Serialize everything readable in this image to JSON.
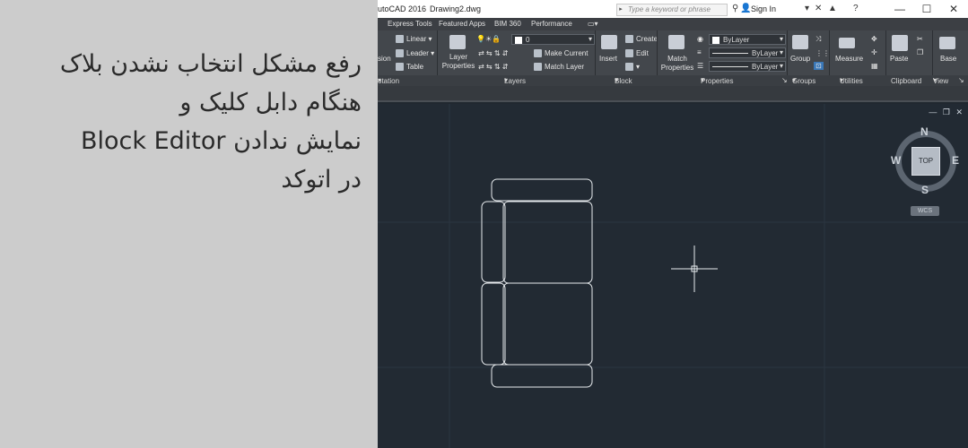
{
  "overlay": {
    "line1": "رفع مشکل انتخاب نشدن بلاک",
    "line2": "هنگام دابل کلیک و",
    "line3": "نمایش ندادن Block Editor",
    "line4": "در اتوکد"
  },
  "titlebar": {
    "app_title": "utoCAD 2016",
    "file_name": "Drawing2.dwg",
    "search_placeholder": "Type a keyword or phrase",
    "signin": "Sign In",
    "minimize": "—",
    "maximize": "☐",
    "close": "✕"
  },
  "menubar": {
    "items": [
      "Express Tools",
      "Featured Apps",
      "BIM 360",
      "Performance"
    ]
  },
  "ribbon": {
    "annotation": {
      "linear": "Linear",
      "leader": "Leader",
      "table": "Table",
      "dimension_fragment": "sion"
    },
    "layers": {
      "layer_properties": "Layer Properties",
      "current_layer": "0",
      "make_current": "Make Current",
      "match_layer": "Match Layer"
    },
    "block": {
      "insert": "Insert",
      "create": "Create",
      "edit": "Edit"
    },
    "properties": {
      "match_properties": "Match Properties",
      "color": "ByLayer",
      "linetype": "ByLayer",
      "lineweight": "ByLayer"
    },
    "groups": {
      "group": "Group"
    },
    "utilities": {
      "measure": "Measure"
    },
    "clipboard": {
      "paste": "Paste"
    },
    "view": {
      "base": "Base"
    },
    "panel_titles": {
      "annotation": "otation",
      "layers": "Layers",
      "block": "Block",
      "properties": "Properties",
      "groups": "Groups",
      "utilities": "Utilities",
      "clipboard": "Clipboard",
      "view": "View"
    }
  },
  "viewport": {
    "controls": [
      "—",
      "❐",
      "✕"
    ],
    "viewcube": {
      "top": "TOP",
      "north": "N",
      "south": "S",
      "east": "E",
      "west": "W"
    },
    "wcs": "WCS"
  },
  "colors": {
    "viewport_bg": "#222a33",
    "ribbon_bg": "#43474c",
    "geometry": "#e8ecef"
  }
}
